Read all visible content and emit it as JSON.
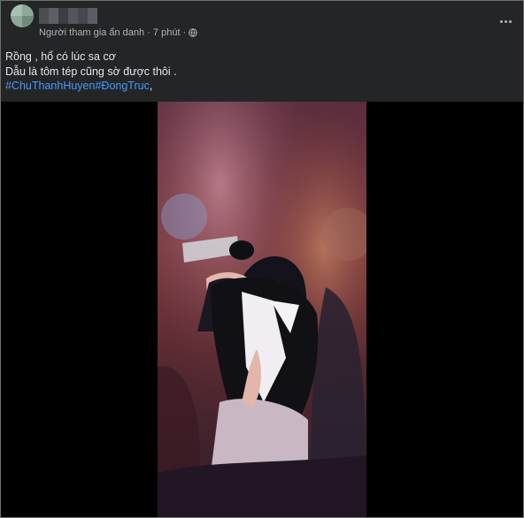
{
  "post": {
    "author_meta": "Người tham gia ẩn danh · 7 phút ·",
    "globe_icon": "globe-icon",
    "more_icon": "more-horizontal-icon",
    "text_line1": "Rồng , hổ có lúc sa cơ",
    "text_line2": "Dẫu là tôm tép cũng sờ được thôi .",
    "hashtag1": "#ChuThanhHuyen",
    "hashtag2": "#ĐongTruc",
    "hashtag_suffix": ","
  },
  "colors": {
    "card_background": "#242526",
    "text_primary": "#e4e6eb",
    "text_secondary": "#b0b3b8",
    "hashtag": "#4599ff",
    "media_background": "#000000"
  }
}
